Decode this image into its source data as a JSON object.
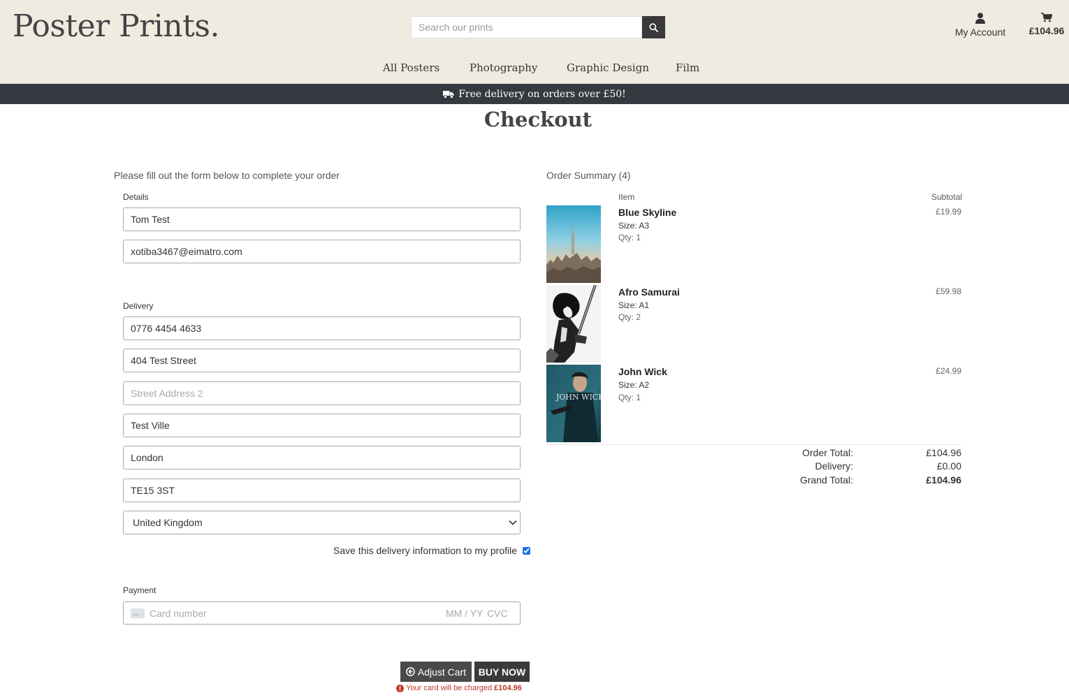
{
  "header": {
    "logo": "Poster Prints.",
    "search_placeholder": "Search our prints",
    "account_label": "My Account",
    "cart_total": "£104.96"
  },
  "nav": [
    "All Posters",
    "Photography",
    "Graphic Design",
    "Film"
  ],
  "banner": "Free delivery on orders over £50!",
  "page_title": "Checkout",
  "form": {
    "intro": "Please fill out the form below to complete your order",
    "details_legend": "Details",
    "full_name": "Tom Test",
    "email": "xotiba3467@eimatro.com",
    "delivery_legend": "Delivery",
    "phone": "0776 4454 4633",
    "street1": "404 Test Street",
    "street2_placeholder": "Street Address 2",
    "town": "Test Ville",
    "county": "London",
    "postcode": "TE15 3ST",
    "country": "United Kingdom",
    "save_info_label": "Save this delivery information to my profile",
    "payment_legend": "Payment",
    "card_placeholder": "Card number",
    "card_expiry_placeholder": "MM / YY",
    "card_cvc_placeholder": "CVC"
  },
  "buttons": {
    "adjust_cart": "Adjust Cart",
    "buy_now": "BUY NOW"
  },
  "charge_note": {
    "prefix": "Your card will be charged",
    "amount": "£104.96"
  },
  "summary": {
    "title": "Order Summary (4)",
    "col_item": "Item",
    "col_subtotal": "Subtotal",
    "items": [
      {
        "name": "Blue Skyline",
        "size": "Size: A3",
        "qty": "Qty: 1",
        "subtotal": "£19.99"
      },
      {
        "name": "Afro Samurai",
        "size": "Size: A1",
        "qty": "Qty: 2",
        "subtotal": "£59.98"
      },
      {
        "name": "John Wick",
        "size": "Size: A2",
        "qty": "Qty: 1",
        "subtotal": "£24.99",
        "poster_text": "JOHN WICK"
      }
    ],
    "order_total_label": "Order Total:",
    "order_total": "£104.96",
    "delivery_label": "Delivery:",
    "delivery": "£0.00",
    "grand_total_label": "Grand Total:",
    "grand_total": "£104.96"
  }
}
